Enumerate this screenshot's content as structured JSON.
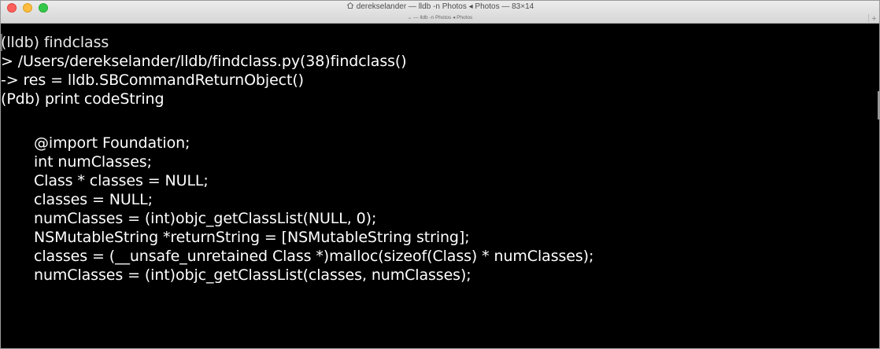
{
  "window": {
    "title": "derekselander — lldb -n Photos ◂ Photos — 83×14",
    "tab_label": "lldb -n Photos ◂ Photos",
    "new_tab_symbol": "+"
  },
  "terminal": {
    "lines": [
      "(lldb) findclass",
      "> /Users/derekselander/lldb/findclass.py(38)findclass()",
      "-> res = lldb.SBCommandReturnObject()",
      "(Pdb) print codeString",
      "",
      "@import Foundation;",
      "int numClasses;",
      "Class * classes = NULL;",
      "classes = NULL;",
      "numClasses = (int)objc_getClassList(NULL, 0);",
      "NSMutableString *returnString = [NSMutableString string];",
      "classes = (__unsafe_unretained Class *)malloc(sizeof(Class) * numClasses);",
      "numClasses = (int)objc_getClassList(classes, numClasses);"
    ]
  },
  "icons": {
    "title_icon": "home-icon",
    "tab_icon": "chevron-down-icon"
  },
  "colors": {
    "terminal_background": "#000000",
    "terminal_text": "#ffffff",
    "titlebar": "#e3e3e3",
    "close": "#fc605c",
    "minimize": "#fdbc40",
    "zoom": "#34c84a"
  }
}
